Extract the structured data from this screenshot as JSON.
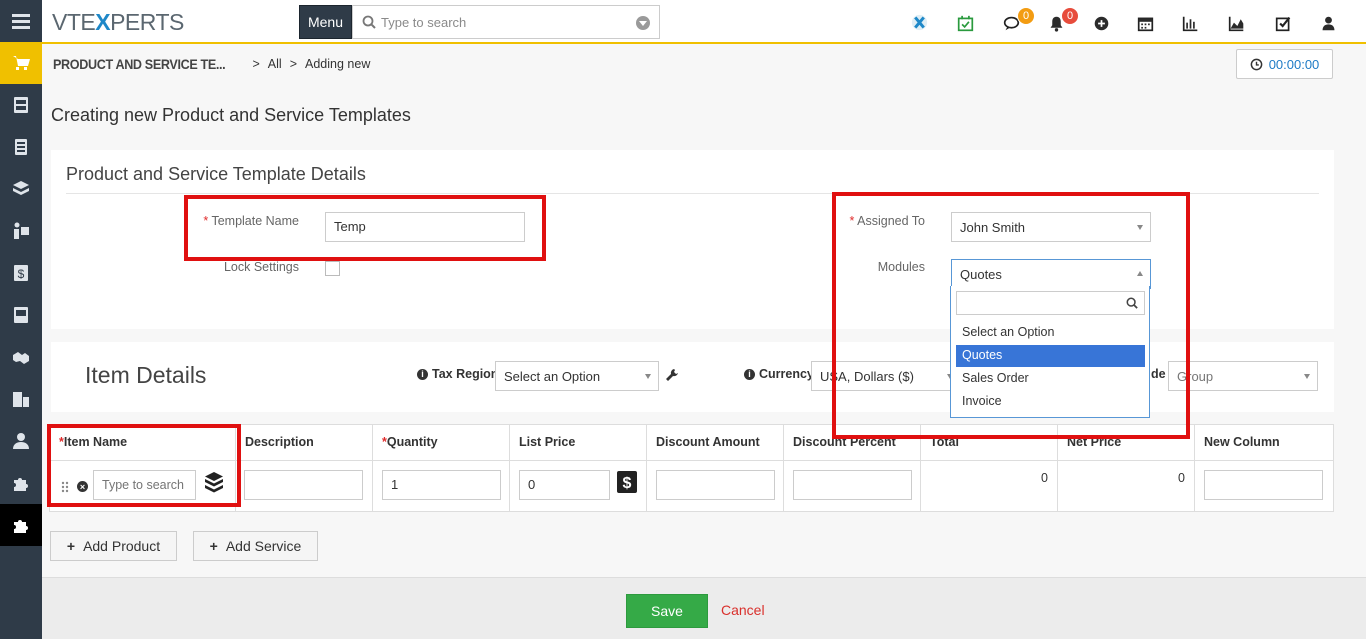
{
  "app": {
    "logo_left": "VTE",
    "logo_x": "X",
    "logo_right": "PERTS",
    "menu_label": "Menu",
    "search_placeholder": "Type to search"
  },
  "topbar": {
    "comments_badge": "0",
    "notifications_badge": "0",
    "badge_colors": {
      "comments": "#f39c12",
      "notifications": "#e74c3c"
    }
  },
  "sidebar": {
    "items": [
      "menu-icon",
      "products-icon",
      "sales-order-icon",
      "quotes-icon",
      "services-icon",
      "assets-icon",
      "invoice-icon",
      "purchase-order-icon",
      "handshake-icon",
      "organizations-icon",
      "contacts-icon",
      "extensions-icon",
      "templates-icon"
    ]
  },
  "breadcrumb": {
    "module": "PRODUCT AND SERVICE TE...",
    "all": "All",
    "current": "Adding new"
  },
  "timer": "00:00:00",
  "page_title": "Creating new Product and Service Templates",
  "details": {
    "heading": "Product and Service Template Details",
    "template_name_label": "Template Name",
    "template_name_value": "Temp",
    "lock_settings_label": "Lock Settings",
    "assigned_to_label": "Assigned To",
    "assigned_to_value": "John Smith",
    "modules_label": "Modules",
    "modules_value": "Quotes",
    "modules_options": [
      "Select an Option",
      "Quotes",
      "Sales Order",
      "Invoice"
    ]
  },
  "items": {
    "heading": "Item Details",
    "tax_region_label": "Tax Region",
    "tax_region_value": "Select an Option",
    "currency_label": "Currency",
    "currency_value": "USA, Dollars ($)",
    "tax_mode_label": "de",
    "tax_mode_value": "Group",
    "columns": [
      "Item Name",
      "Description",
      "Quantity",
      "List Price",
      "Discount Amount",
      "Discount Percent",
      "Total",
      "Net Price",
      "New Column"
    ],
    "row": {
      "item_placeholder": "Type to search",
      "quantity": "1",
      "list_price": "0",
      "total": "0",
      "net_price": "0"
    }
  },
  "buttons": {
    "add_product": "Add Product",
    "add_service": "Add Service",
    "save": "Save",
    "cancel": "Cancel"
  },
  "colors": {
    "sidebar": "#2f3b48",
    "accent": "#1e88c8",
    "save": "#35aa47",
    "highlight": "#e01010"
  }
}
